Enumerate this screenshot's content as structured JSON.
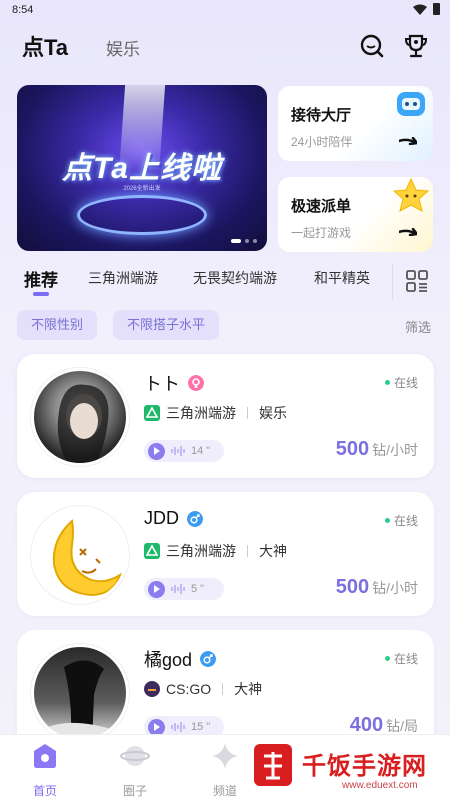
{
  "status_bar": {
    "time": "8:54"
  },
  "header": {
    "logo": "点Ta",
    "tab": "娱乐"
  },
  "banner": {
    "title": "点Ta上线啦",
    "subtitle": "2026全新出发"
  },
  "side_cards": [
    {
      "title": "接待大厅",
      "subtitle": "24小时陪伴"
    },
    {
      "title": "极速派单",
      "subtitle": "一起打游戏"
    }
  ],
  "category_tabs": [
    "推荐",
    "三角洲端游",
    "无畏契约端游",
    "和平精英"
  ],
  "filters": {
    "chips": [
      "不限性别",
      "不限搭子水平"
    ],
    "link": "筛选"
  },
  "users": [
    {
      "name": "トト",
      "status": "在线",
      "game": "三角洲端游",
      "tag": "娱乐",
      "voice": "14 \"",
      "price": "500",
      "unit": "钻/小时",
      "gender_color": "#ff6fa8"
    },
    {
      "name": "JDD",
      "status": "在线",
      "game": "三角洲端游",
      "tag": "大神",
      "voice": "5 \"",
      "price": "500",
      "unit": "钻/小时",
      "gender_color": "#3a9bf0"
    },
    {
      "name": "橘god",
      "status": "在线",
      "game": "CS:GO",
      "tag": "大神",
      "voice": "15 \"",
      "price": "400",
      "unit": "钻/局",
      "gender_color": "#3a9bf0"
    }
  ],
  "bottom_nav": [
    {
      "label": "首页",
      "icon": "home-icon",
      "active": true
    },
    {
      "label": "圈子",
      "icon": "planet-icon",
      "active": false
    },
    {
      "label": "频道",
      "icon": "sparkle-icon",
      "active": false
    }
  ],
  "watermark": {
    "text": "千饭手游网",
    "url": "www.eduext.com"
  },
  "colors": {
    "accent": "#7c6cf3",
    "online": "#2ecc8a",
    "price": "#7d6fe0"
  }
}
